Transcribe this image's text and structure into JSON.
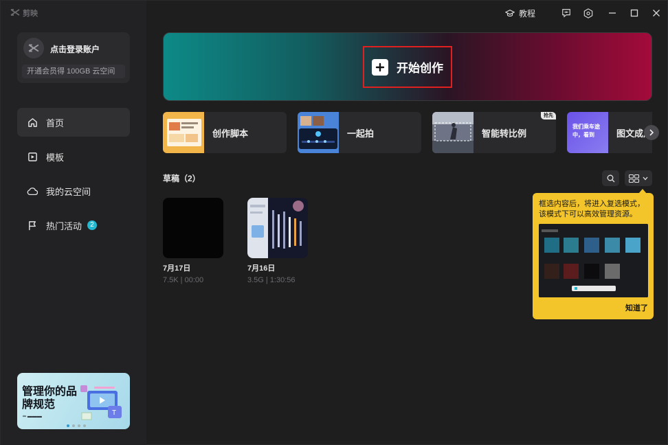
{
  "app": {
    "brand": "剪映"
  },
  "account": {
    "login_label": "点击登录账户",
    "vip_label": "开通会员得 100GB 云空间"
  },
  "nav": {
    "items": [
      {
        "label": "首页",
        "icon": "home-icon",
        "active": true
      },
      {
        "label": "模板",
        "icon": "template-icon"
      },
      {
        "label": "我的云空间",
        "icon": "cloud-icon"
      },
      {
        "label": "热门活动",
        "icon": "flag-icon",
        "badge": "2"
      }
    ]
  },
  "promo": {
    "title": "管理你的品牌规范"
  },
  "titlebar": {
    "tutorial_label": "教程"
  },
  "hero": {
    "start_label": "开始创作"
  },
  "tools": [
    {
      "label": "创作脚本",
      "thumb_text": "工作脚本 ..."
    },
    {
      "label": "一起拍"
    },
    {
      "label": "智能转比例",
      "tag": "抢先"
    },
    {
      "label": "图文成片",
      "thumb_text": "我们乘车途中，看到"
    }
  ],
  "drafts": {
    "title": "草稿（2）",
    "items": [
      {
        "date": "7月17日",
        "meta": "7.5K | 00:00"
      },
      {
        "date": "7月16日",
        "meta": "3.5G | 1:30:56"
      }
    ]
  },
  "tooltip": {
    "text": "框选内容后，将进入复选模式，该模式下可以高效管理资源。",
    "ok_label": "知道了"
  },
  "colors": {
    "accent_badge": "#22b8cf",
    "tooltip_bg": "#f3c52a",
    "highlight_border": "#e0201f"
  }
}
